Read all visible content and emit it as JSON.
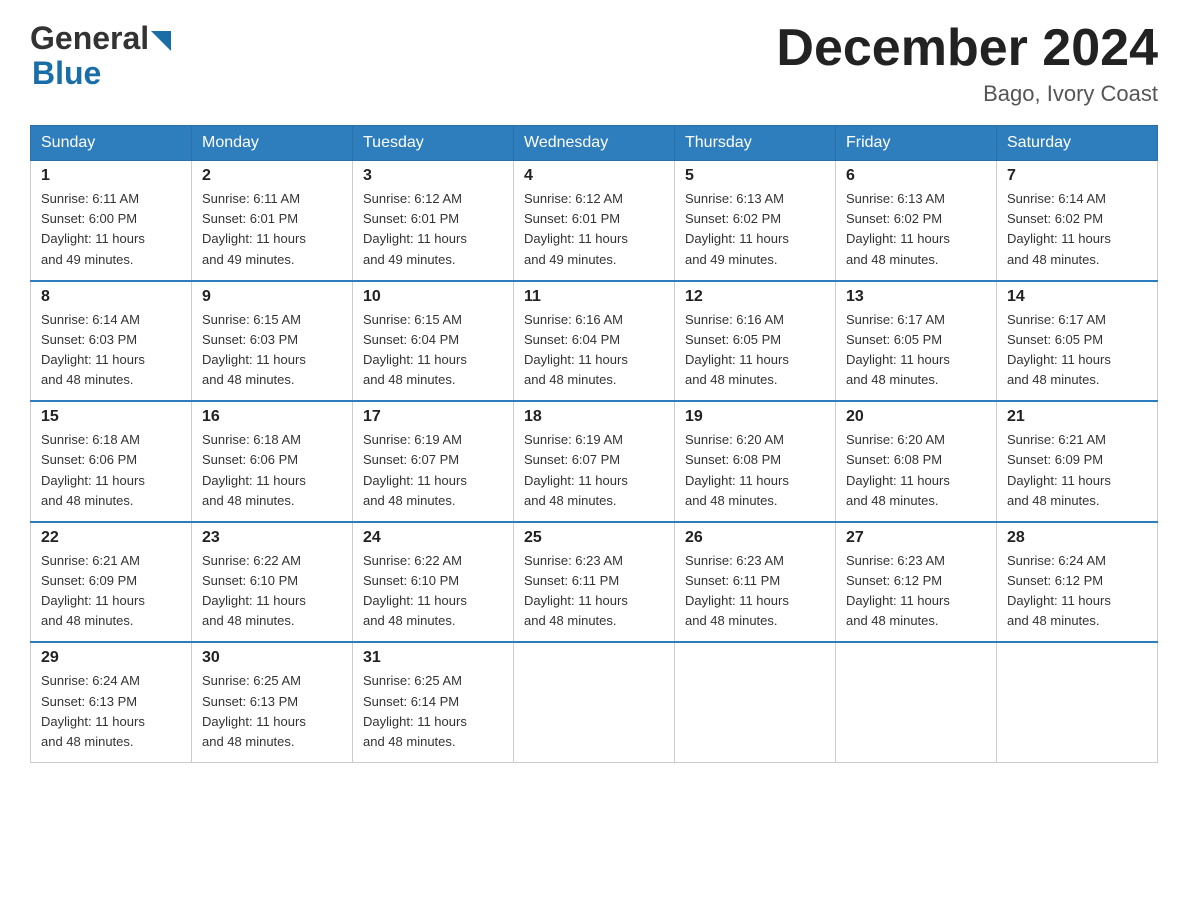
{
  "header": {
    "logo_general": "General",
    "logo_blue": "Blue",
    "month_title": "December 2024",
    "location": "Bago, Ivory Coast"
  },
  "weekdays": [
    "Sunday",
    "Monday",
    "Tuesday",
    "Wednesday",
    "Thursday",
    "Friday",
    "Saturday"
  ],
  "weeks": [
    [
      {
        "day": "1",
        "sunrise": "6:11 AM",
        "sunset": "6:00 PM",
        "daylight": "11 hours and 49 minutes."
      },
      {
        "day": "2",
        "sunrise": "6:11 AM",
        "sunset": "6:01 PM",
        "daylight": "11 hours and 49 minutes."
      },
      {
        "day": "3",
        "sunrise": "6:12 AM",
        "sunset": "6:01 PM",
        "daylight": "11 hours and 49 minutes."
      },
      {
        "day": "4",
        "sunrise": "6:12 AM",
        "sunset": "6:01 PM",
        "daylight": "11 hours and 49 minutes."
      },
      {
        "day": "5",
        "sunrise": "6:13 AM",
        "sunset": "6:02 PM",
        "daylight": "11 hours and 49 minutes."
      },
      {
        "day": "6",
        "sunrise": "6:13 AM",
        "sunset": "6:02 PM",
        "daylight": "11 hours and 48 minutes."
      },
      {
        "day": "7",
        "sunrise": "6:14 AM",
        "sunset": "6:02 PM",
        "daylight": "11 hours and 48 minutes."
      }
    ],
    [
      {
        "day": "8",
        "sunrise": "6:14 AM",
        "sunset": "6:03 PM",
        "daylight": "11 hours and 48 minutes."
      },
      {
        "day": "9",
        "sunrise": "6:15 AM",
        "sunset": "6:03 PM",
        "daylight": "11 hours and 48 minutes."
      },
      {
        "day": "10",
        "sunrise": "6:15 AM",
        "sunset": "6:04 PM",
        "daylight": "11 hours and 48 minutes."
      },
      {
        "day": "11",
        "sunrise": "6:16 AM",
        "sunset": "6:04 PM",
        "daylight": "11 hours and 48 minutes."
      },
      {
        "day": "12",
        "sunrise": "6:16 AM",
        "sunset": "6:05 PM",
        "daylight": "11 hours and 48 minutes."
      },
      {
        "day": "13",
        "sunrise": "6:17 AM",
        "sunset": "6:05 PM",
        "daylight": "11 hours and 48 minutes."
      },
      {
        "day": "14",
        "sunrise": "6:17 AM",
        "sunset": "6:05 PM",
        "daylight": "11 hours and 48 minutes."
      }
    ],
    [
      {
        "day": "15",
        "sunrise": "6:18 AM",
        "sunset": "6:06 PM",
        "daylight": "11 hours and 48 minutes."
      },
      {
        "day": "16",
        "sunrise": "6:18 AM",
        "sunset": "6:06 PM",
        "daylight": "11 hours and 48 minutes."
      },
      {
        "day": "17",
        "sunrise": "6:19 AM",
        "sunset": "6:07 PM",
        "daylight": "11 hours and 48 minutes."
      },
      {
        "day": "18",
        "sunrise": "6:19 AM",
        "sunset": "6:07 PM",
        "daylight": "11 hours and 48 minutes."
      },
      {
        "day": "19",
        "sunrise": "6:20 AM",
        "sunset": "6:08 PM",
        "daylight": "11 hours and 48 minutes."
      },
      {
        "day": "20",
        "sunrise": "6:20 AM",
        "sunset": "6:08 PM",
        "daylight": "11 hours and 48 minutes."
      },
      {
        "day": "21",
        "sunrise": "6:21 AM",
        "sunset": "6:09 PM",
        "daylight": "11 hours and 48 minutes."
      }
    ],
    [
      {
        "day": "22",
        "sunrise": "6:21 AM",
        "sunset": "6:09 PM",
        "daylight": "11 hours and 48 minutes."
      },
      {
        "day": "23",
        "sunrise": "6:22 AM",
        "sunset": "6:10 PM",
        "daylight": "11 hours and 48 minutes."
      },
      {
        "day": "24",
        "sunrise": "6:22 AM",
        "sunset": "6:10 PM",
        "daylight": "11 hours and 48 minutes."
      },
      {
        "day": "25",
        "sunrise": "6:23 AM",
        "sunset": "6:11 PM",
        "daylight": "11 hours and 48 minutes."
      },
      {
        "day": "26",
        "sunrise": "6:23 AM",
        "sunset": "6:11 PM",
        "daylight": "11 hours and 48 minutes."
      },
      {
        "day": "27",
        "sunrise": "6:23 AM",
        "sunset": "6:12 PM",
        "daylight": "11 hours and 48 minutes."
      },
      {
        "day": "28",
        "sunrise": "6:24 AM",
        "sunset": "6:12 PM",
        "daylight": "11 hours and 48 minutes."
      }
    ],
    [
      {
        "day": "29",
        "sunrise": "6:24 AM",
        "sunset": "6:13 PM",
        "daylight": "11 hours and 48 minutes."
      },
      {
        "day": "30",
        "sunrise": "6:25 AM",
        "sunset": "6:13 PM",
        "daylight": "11 hours and 48 minutes."
      },
      {
        "day": "31",
        "sunrise": "6:25 AM",
        "sunset": "6:14 PM",
        "daylight": "11 hours and 48 minutes."
      },
      null,
      null,
      null,
      null
    ]
  ],
  "labels": {
    "sunrise": "Sunrise:",
    "sunset": "Sunset:",
    "daylight": "Daylight:"
  }
}
